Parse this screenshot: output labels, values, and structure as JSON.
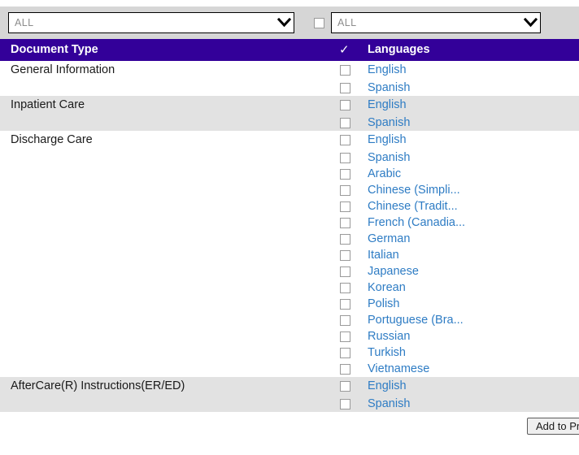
{
  "filter_bar": {
    "doc_type_select": {
      "value": "ALL",
      "icon": "chevron-down-icon"
    },
    "select_all_checkbox": {
      "checked": false
    },
    "language_select": {
      "value": "ALL",
      "icon": "chevron-down-icon"
    }
  },
  "table": {
    "headers": {
      "document_type": "Document Type",
      "check": "✓",
      "languages": "Languages"
    },
    "groups": [
      {
        "document_type": "General Information",
        "striped": false,
        "languages": [
          {
            "label": "English",
            "checked": false
          },
          {
            "label": "Spanish",
            "checked": false
          }
        ]
      },
      {
        "document_type": "Inpatient Care",
        "striped": true,
        "languages": [
          {
            "label": "English",
            "checked": false
          },
          {
            "label": "Spanish",
            "checked": false
          }
        ]
      },
      {
        "document_type": "Discharge Care",
        "striped": false,
        "languages": [
          {
            "label": "English",
            "checked": false
          },
          {
            "label": "Spanish",
            "checked": false
          },
          {
            "label": "Arabic",
            "checked": false
          },
          {
            "label": "Chinese (Simpli...",
            "checked": false
          },
          {
            "label": "Chinese (Tradit...",
            "checked": false
          },
          {
            "label": "French (Canadia...",
            "checked": false
          },
          {
            "label": "German",
            "checked": false
          },
          {
            "label": "Italian",
            "checked": false
          },
          {
            "label": "Japanese",
            "checked": false
          },
          {
            "label": "Korean",
            "checked": false
          },
          {
            "label": "Polish",
            "checked": false
          },
          {
            "label": "Portuguese (Bra...",
            "checked": false
          },
          {
            "label": "Russian",
            "checked": false
          },
          {
            "label": "Turkish",
            "checked": false
          },
          {
            "label": "Vietnamese",
            "checked": false
          }
        ]
      },
      {
        "document_type": "AfterCare(R) Instructions(ER/ED)",
        "striped": true,
        "languages": [
          {
            "label": "English",
            "checked": false
          },
          {
            "label": "Spanish",
            "checked": false
          }
        ]
      }
    ]
  },
  "footer": {
    "add_button_label": "Add to Pr"
  },
  "colors": {
    "header_purple": "#330099",
    "toolbar_gray": "#d6d6d6",
    "row_stripe": "#e2e2e2",
    "link_blue": "#2e7cc4"
  }
}
